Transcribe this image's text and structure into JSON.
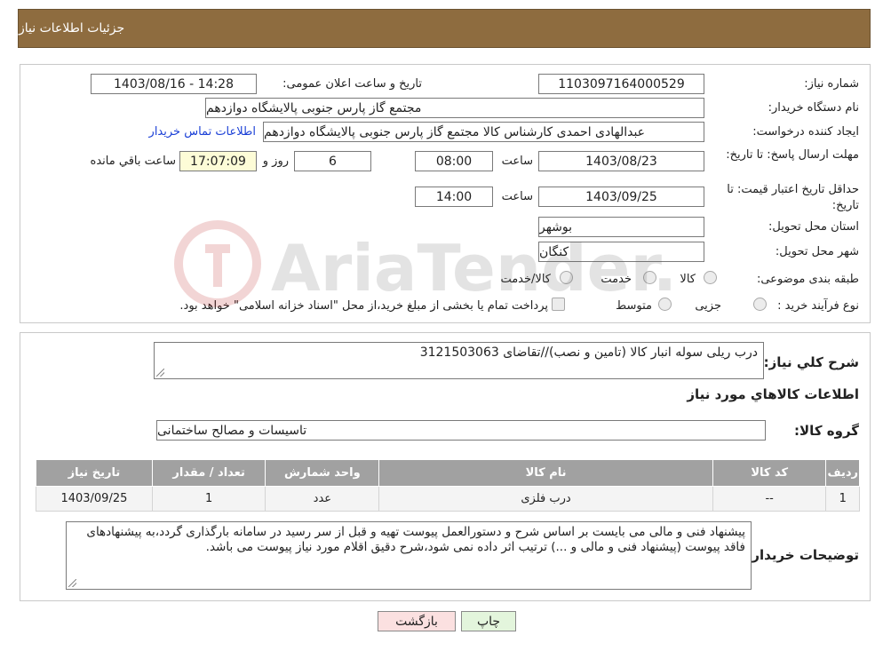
{
  "header": {
    "title": "جزئیات اطلاعات نیاز"
  },
  "form": {
    "need_number": {
      "label": "شماره نیاز:",
      "value": "1103097164000529"
    },
    "announce": {
      "label": "تاریخ و ساعت اعلان عمومی:",
      "value": "1403/08/16 - 14:28"
    },
    "buyer_org": {
      "label": "نام دستگاه خریدار:",
      "value": "مجتمع گاز پارس جنوبی  پالایشگاه دوازدهم"
    },
    "requester": {
      "label": "ایجاد کننده درخواست:",
      "value": "عبدالهادی احمدی کارشناس کالا مجتمع گاز پارس جنوبی  پالایشگاه دوازدهم",
      "contact_link": "اطلاعات تماس خریدار"
    },
    "reply_deadline": {
      "label": "مهلت ارسال پاسخ: تا تاریخ:",
      "date": "1403/08/23",
      "time_label": "ساعت",
      "time": "08:00",
      "days": "6",
      "days_label": "روز و",
      "remaining": "17:07:09",
      "remaining_label": "ساعت باقي مانده"
    },
    "price_validity": {
      "label": "حداقل تاریخ اعتبار قیمت: تا تاریخ:",
      "date": "1403/09/25",
      "time_label": "ساعت",
      "time": "14:00"
    },
    "province": {
      "label": "استان محل تحویل:",
      "value": "بوشهر"
    },
    "city": {
      "label": "شهر محل تحویل:",
      "value": "کنگان"
    },
    "category": {
      "label": "طبقه بندی موضوعی:",
      "options": [
        "کالا",
        "خدمت",
        "کالا/خدمت"
      ]
    },
    "process_type": {
      "label": "نوع فرآیند خرید :",
      "options": [
        "جزیی",
        "متوسط"
      ],
      "note": "پرداخت تمام یا بخشی از مبلغ خرید،از محل \"اسناد خزانه اسلامی\" خواهد بود."
    }
  },
  "details": {
    "description_label": "شرح کلي نياز:",
    "description": "درب ریلی سوله انبار کالا (تامین و نصب)//تقاضای 3121503063",
    "items_title": "اطلاعات كالاهاي مورد نياز",
    "group_label": "گروه کالا:",
    "group_value": "تاسیسات و مصالح ساختمانی",
    "table": {
      "headers": [
        "رديف",
        "کد کالا",
        "نام کالا",
        "واحد شمارش",
        "تعداد / مقدار",
        "تاریخ نیاز"
      ],
      "rows": [
        [
          "1",
          "--",
          "درب فلزی",
          "عدد",
          "1",
          "1403/09/25"
        ]
      ]
    },
    "buyer_notes_label": "توضیحات خریدار:",
    "buyer_notes": "پیشنهاد فنی و مالی می بایست بر اساس شرح و دستورالعمل پیوست تهیه و قبل از سر رسید در سامانه بارگذاری گردد،به پیشنهادهای فاقد پیوست (پیشنهاد فنی و مالی و ...) ترتیب اثر داده نمی شود،شرح دقیق اقلام مورد نیاز پیوست می باشد."
  },
  "buttons": {
    "print": "چاپ",
    "back": "بازگشت"
  },
  "colors": {
    "header_bg": "#8e6c3f",
    "table_header_bg": "#a1a1a1",
    "link": "#1a3fd6",
    "back_button_bg": "#fbe0e0",
    "print_button_bg": "#e3f5dc",
    "remaining_bg": "#fdfcd7"
  },
  "watermark": {
    "text": "AriaTender.neT"
  }
}
